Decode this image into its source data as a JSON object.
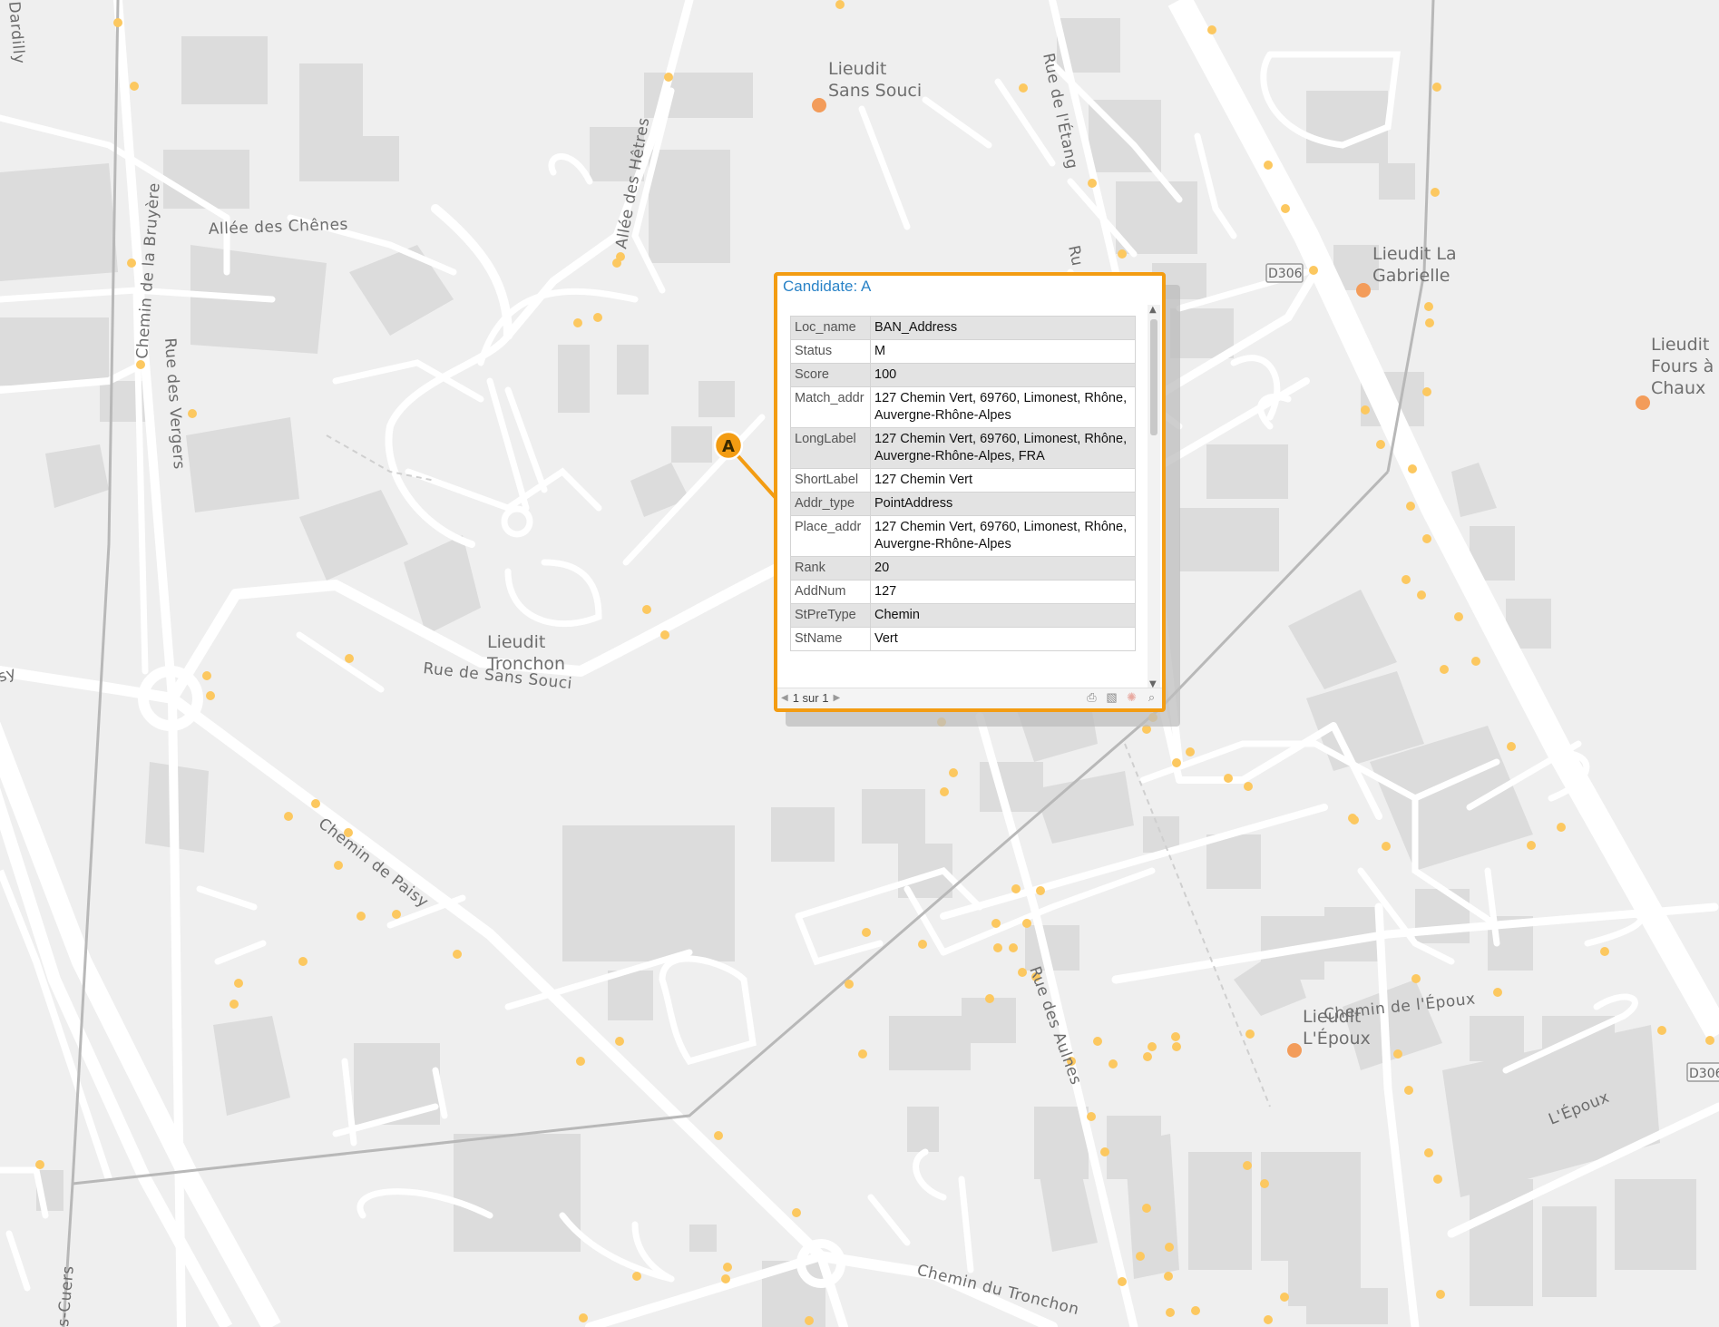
{
  "map": {
    "street_labels": {
      "allee_chenes": "Allée des Chênes",
      "allee_hetres": "Allée des Hêtres",
      "chemin_bruyere": "Chemin de la Bruyère",
      "rue_vergers": "Rue des Vergers",
      "rue_sans_souci": "Rue de Sans Souci",
      "chemin_paisy": "Chemin de Paisy",
      "rue_etang": "Rue de l'Étang",
      "rue_aulnes": "Rue des Aulnes",
      "chemin_tronchon": "Chemin du Tronchon",
      "chemin_epoux": "Chemin de l'Époux",
      "lepoux_road": "L'Époux",
      "dardilly": "Dardilly",
      "cuers": "s-Cuers",
      "sy": "sy",
      "ru": "Ru"
    },
    "places": {
      "sans_souci": [
        "Lieudit",
        "Sans Souci"
      ],
      "la_gabrielle": [
        "Lieudit La",
        "Gabrielle"
      ],
      "fours_chaux": [
        "Lieudit",
        "Fours à",
        "Chaux"
      ],
      "tronchon": [
        "Lieudit",
        "Tronchon"
      ],
      "lepoux": [
        "Lieudit",
        "L'Époux"
      ]
    },
    "shields": {
      "d306_a": "D306",
      "d306_b": "D306"
    },
    "marker_label": "A",
    "colors": {
      "poi": "#f39c5a",
      "address_dot": "#fcc860",
      "accent": "#f39c12"
    }
  },
  "popup": {
    "title": "Candidate: A",
    "rows": [
      {
        "key": "Loc_name",
        "value": "BAN_Address"
      },
      {
        "key": "Status",
        "value": "M"
      },
      {
        "key": "Score",
        "value": "100"
      },
      {
        "key": "Match_addr",
        "value": "127 Chemin Vert, 69760, Limonest, Rhône, Auvergne-Rhône-Alpes"
      },
      {
        "key": "LongLabel",
        "value": "127 Chemin Vert, 69760, Limonest, Rhône, Auvergne-Rhône-Alpes, FRA"
      },
      {
        "key": "ShortLabel",
        "value": "127 Chemin Vert"
      },
      {
        "key": "Addr_type",
        "value": "PointAddress"
      },
      {
        "key": "Place_addr",
        "value": "127 Chemin Vert, 69760, Limonest, Rhône, Auvergne-Rhône-Alpes"
      },
      {
        "key": "Rank",
        "value": "20"
      },
      {
        "key": "AddNum",
        "value": "127"
      },
      {
        "key": "StPreType",
        "value": "Chemin"
      },
      {
        "key": "StName",
        "value": "Vert"
      }
    ],
    "pager_text": "1 sur 1",
    "tools": [
      "print-icon",
      "export-icon",
      "flash-icon",
      "zoom-icon"
    ]
  }
}
